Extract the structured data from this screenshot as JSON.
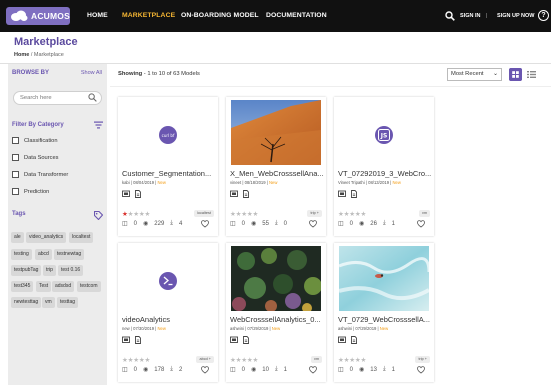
{
  "nav": {
    "logo_text": "ACUMOS",
    "links": [
      "HOME",
      "MARKETPLACE",
      "ON-BOARDING MODEL",
      "DOCUMENTATION"
    ],
    "active": "MARKETPLACE",
    "sign_in": "SIGN IN",
    "separator": "|",
    "sign_up": "SIGN UP NOW",
    "help": "?"
  },
  "page": {
    "title": "Marketplace",
    "breadcrumb_home": "Home",
    "breadcrumb_sep": "/",
    "breadcrumb_current": "Marketplace"
  },
  "sidebar": {
    "browse_by": "BROWSE BY",
    "show_all": "Show All",
    "search_placeholder": "Search here",
    "filter_title": "Filter By Category",
    "categories": [
      "Classification",
      "Data Sources",
      "Data Transformer",
      "Prediction"
    ],
    "tags_title": "Tags",
    "tags": [
      "ale",
      "video_analytics",
      "localtest",
      "testing",
      "abcd",
      "testnewtag",
      "testpubTag",
      "trip",
      "test 0.16",
      "test345",
      "Test",
      "adsdsd",
      "testcom",
      "newtesttag",
      "vm",
      "testtag"
    ]
  },
  "main": {
    "showing_label": "Showing",
    "showing_range": "- 1 to 10 of 63 Models",
    "sort_value": "Most Recent",
    "cards": [
      {
        "name": "Customer_Segmentation...",
        "author": "kabi",
        "date": "08/04/2019",
        "badge": "New",
        "tag": "localtest",
        "stars": 1,
        "comments": "0",
        "views": "229",
        "downloads": "4",
        "image": "logo-curlbf",
        "logo_text": "curl bf"
      },
      {
        "name": "X_Men_WebCrosssellAna...",
        "author": "vineet",
        "date": "08/18/2019",
        "badge": "New",
        "tag": "trip +",
        "stars": 0,
        "comments": "0",
        "views": "55",
        "downloads": "0",
        "image": "photo-desert-tree"
      },
      {
        "name": "VT_07292019_3_WebCro...",
        "author": "Vineet Tripathi",
        "date": "08/13/2019",
        "badge": "New",
        "tag": "vm",
        "stars": 0,
        "comments": "0",
        "views": "26",
        "downloads": "1",
        "image": "logo-js",
        "logo_text": "JS"
      },
      {
        "name": "videoAnalytics",
        "author": "new",
        "date": "07/30/2019",
        "badge": "New",
        "tag": "abcd +",
        "stars": 0,
        "comments": "0",
        "views": "178",
        "downloads": "2",
        "image": "logo-terminal"
      },
      {
        "name": "WebCrosssellAnalytics_0...",
        "author": "ashwini",
        "date": "07/29/2019",
        "badge": "New",
        "tag": "vm",
        "stars": 0,
        "comments": "0",
        "views": "10",
        "downloads": "1",
        "image": "photo-succulents"
      },
      {
        "name": "VT_0729_WebCrosssellA...",
        "author": "ashwini",
        "date": "07/29/2019",
        "badge": "New",
        "tag": "trip +",
        "stars": 0,
        "comments": "0",
        "views": "13",
        "downloads": "1",
        "image": "photo-ice-water"
      }
    ]
  },
  "colors": {
    "brand_purple": "#6a56b0",
    "nav_bg": "#111111",
    "nav_active": "#f7b733",
    "badge_new": "#f39c12",
    "star_on": "#d9302c"
  }
}
